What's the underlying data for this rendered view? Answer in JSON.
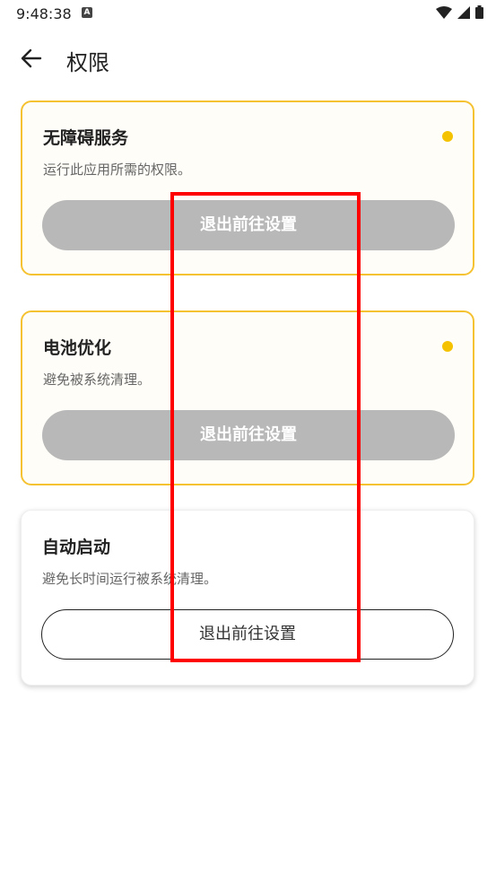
{
  "status": {
    "time": "9:48:38",
    "notif_badge": "A"
  },
  "appbar": {
    "title": "权限",
    "back_icon": "arrow-left-icon"
  },
  "cards": [
    {
      "title": "无障碍服务",
      "desc": "运行此应用所需的权限。",
      "button": "退出前往设置",
      "state": "warning"
    },
    {
      "title": "电池优化",
      "desc": "避免被系统清理。",
      "button": "退出前往设置",
      "state": "warning"
    },
    {
      "title": "自动启动",
      "desc": "避免长时间运行被系统清理。",
      "button": "退出前往设置",
      "state": "normal"
    }
  ],
  "colors": {
    "warning_dot": "#f5c200",
    "warning_border": "#f5c232",
    "disabled_btn": "#b8b8b8",
    "highlight": "#ff0000"
  }
}
